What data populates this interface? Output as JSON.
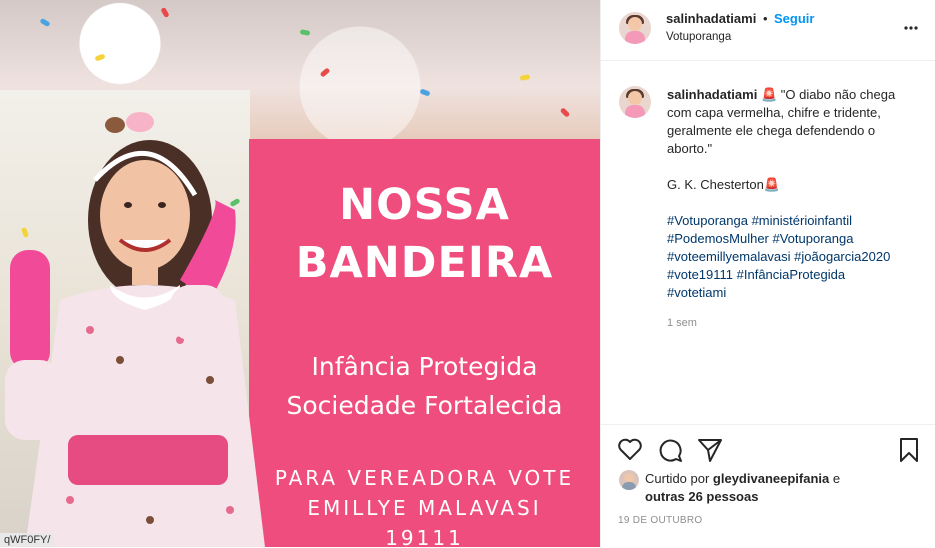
{
  "media": {
    "panel_title_1": "NOSSA",
    "panel_title_2": "BANDEIRA",
    "panel_sub_1": "Infância Protegida",
    "panel_sub_2": "Sociedade Fortalecida",
    "panel_small_1": "PARA VEREADORA VOTE",
    "panel_small_2": "EMILLYE MALAVASI",
    "panel_small_3": "19111",
    "corner_tag": "qWF0FY/",
    "colors": {
      "panel": "#ef4d7d"
    }
  },
  "header": {
    "username": "salinhadatiami",
    "dot": "•",
    "follow_label": "Seguir",
    "location": "Votuporanga",
    "more_icon": "more-horizontal-icon"
  },
  "caption": {
    "username": "salinhadatiami",
    "emoji": "🚨",
    "quote": "\"O diabo não chega com capa vermelha, chifre e tridente, geralmente ele chega defendendo o aborto.\"",
    "author": "G. K. Chesterton🚨",
    "hashtags_line1": "#Votuporanga #ministérioinfantil",
    "hashtags_line2": "#PodemosMulher #Votuporanga",
    "hashtags_line3": "#voteemillyemalavasi #joãogarcia2020",
    "hashtags_line4": "#vote19111 #InfânciaProtegida",
    "hashtags_line5": "#votetiami",
    "time": "1 sem"
  },
  "actions": {
    "like_icon": "heart-icon",
    "comment_icon": "comment-icon",
    "share_icon": "share-icon",
    "save_icon": "bookmark-icon"
  },
  "likes": {
    "prefix": "Curtido por ",
    "user": "gleydivaneepifania",
    "conj": " e",
    "others": "outras 26 pessoas"
  },
  "date": "19 DE OUTUBRO"
}
